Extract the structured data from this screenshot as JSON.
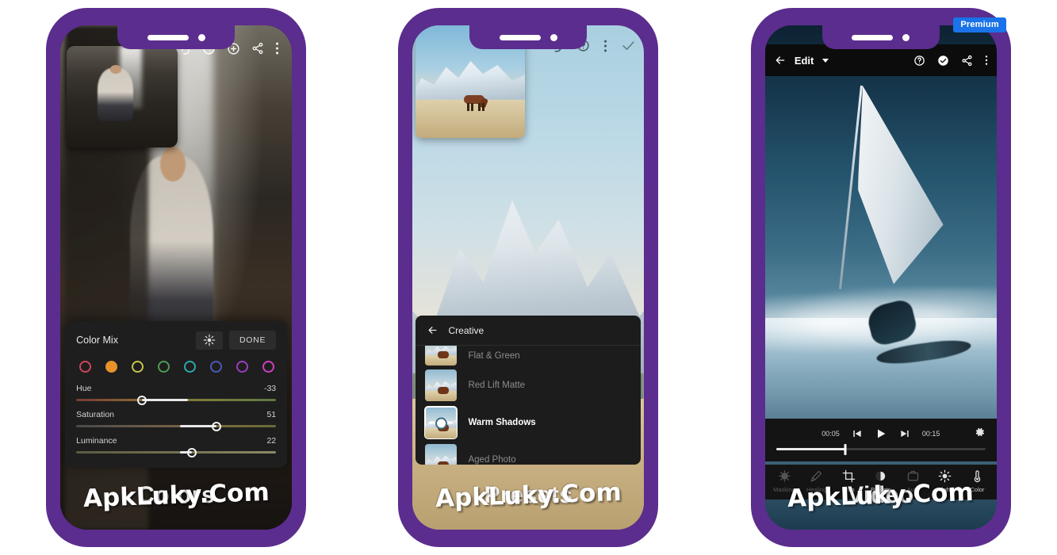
{
  "background_color": "#ffffff",
  "frame_color": "#5b2d8e",
  "watermark": "ApkLuky.Com",
  "phones": [
    {
      "id": "phone-colors",
      "caption": "Colors",
      "premium_badge": null,
      "toolbar_icons": [
        "undo-icon",
        "history-icon",
        "add-icon",
        "share-icon",
        "more-vertical-icon"
      ],
      "panel": {
        "title": "Color Mix",
        "picker_icon": "target-picker-icon",
        "done_label": "DONE",
        "swatches": [
          {
            "name": "red",
            "color": "#d0455a",
            "selected": false
          },
          {
            "name": "orange",
            "color": "#e8922a",
            "selected": true
          },
          {
            "name": "yellow",
            "color": "#c8c548",
            "selected": false
          },
          {
            "name": "green",
            "color": "#4f9a55",
            "selected": false
          },
          {
            "name": "aqua",
            "color": "#2aa8b0",
            "selected": false
          },
          {
            "name": "blue",
            "color": "#4a5ab8",
            "selected": false
          },
          {
            "name": "purple",
            "color": "#9b3fc0",
            "selected": false
          },
          {
            "name": "magenta",
            "color": "#cc3fc0",
            "selected": false
          }
        ],
        "sliders": [
          {
            "name": "Hue",
            "value": "-33",
            "percent": 33,
            "fill_from": 33,
            "fill_to": 56,
            "gradient": "linear-gradient(90deg,#7a3a34,#8a6a34,#7c7c3a,#5c7a42)"
          },
          {
            "name": "Saturation",
            "value": "51",
            "percent": 70,
            "fill_from": 52,
            "fill_to": 70,
            "gradient": "linear-gradient(90deg,#4a4a4a,#6a5a4a,#7a6a3a,#6a6a3a)"
          },
          {
            "name": "Luminance",
            "value": "22",
            "percent": 58,
            "fill_from": 52,
            "fill_to": 58,
            "gradient": "linear-gradient(90deg,#5a5a44,#6a6a4a,#7a7a58,#8a8a66)"
          }
        ]
      }
    },
    {
      "id": "phone-presets",
      "caption": "Presets",
      "premium_badge": null,
      "toolbar_icons": [
        "undo-icon",
        "help-circle-icon",
        "more-vertical-icon",
        "check-icon"
      ],
      "panel": {
        "back_icon": "arrow-left-icon",
        "title": "Creative",
        "items": [
          {
            "label": "Flat & Green",
            "selected": false,
            "partial": true
          },
          {
            "label": "Red Lift Matte",
            "selected": false,
            "partial": false
          },
          {
            "label": "Warm Shadows",
            "selected": true,
            "partial": false
          },
          {
            "label": "Aged Photo",
            "selected": false,
            "partial": false
          }
        ]
      }
    },
    {
      "id": "phone-video",
      "caption": "Video",
      "premium_badge": "Premium",
      "topbar": {
        "back_icon": "arrow-left-icon",
        "title": "Edit",
        "dropdown_icon": "chevron-down-icon",
        "icons": [
          "help-circle-icon",
          "check-circle-icon",
          "share-icon",
          "more-vertical-icon"
        ]
      },
      "player": {
        "current_time": "00:05",
        "total_time": "00:15",
        "prev_frame_icon": "previous-frame-icon",
        "play_icon": "play-icon",
        "next_frame_icon": "next-frame-icon",
        "settings_icon": "gear-icon",
        "progress_percent": 33
      },
      "tools": [
        {
          "label": "Masking",
          "icon": "masking-icon",
          "enabled": false
        },
        {
          "label": "Healing",
          "icon": "healing-brush-icon",
          "enabled": false
        },
        {
          "label": "Trim",
          "icon": "crop-icon",
          "enabled": true
        },
        {
          "label": "Presets",
          "icon": "presets-icon",
          "enabled": true
        },
        {
          "label": "Auto",
          "icon": "auto-icon",
          "enabled": false
        },
        {
          "label": "Light",
          "icon": "brightness-icon",
          "enabled": true
        },
        {
          "label": "Color",
          "icon": "color-thermometer-icon",
          "enabled": true
        }
      ]
    }
  ]
}
